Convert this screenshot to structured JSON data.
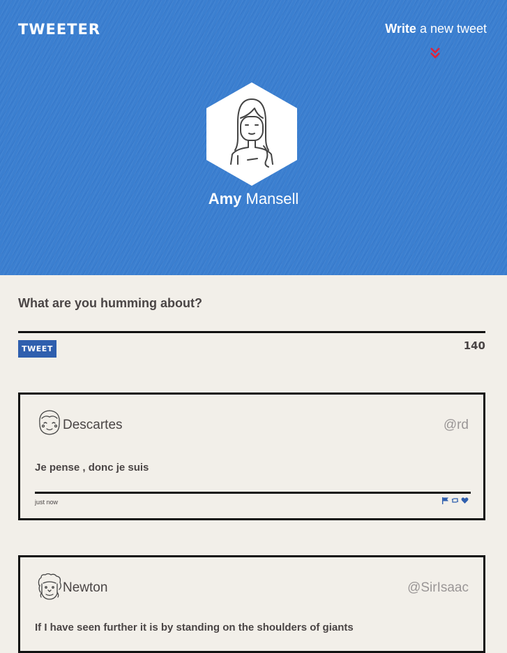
{
  "header": {
    "logo": "TWEETER",
    "write_bold": "Write",
    "write_rest": " a new tweet",
    "profile_first": "Amy",
    "profile_last": " Mansell"
  },
  "compose": {
    "prompt": "What are you humming about?",
    "button_label": "TWEET",
    "counter": "140"
  },
  "tweets": [
    {
      "author": "Descartes",
      "handle": "@rd",
      "text": "Je pense , donc je suis",
      "time": "just now"
    },
    {
      "author": "Newton",
      "handle": "@SirIsaac",
      "text": "If I have seen further it is by standing on the shoulders of giants"
    }
  ],
  "colors": {
    "header_blue": "#3b7fd0",
    "button_blue": "#2f5fae",
    "chevron_red": "#e0223a",
    "background": "#f2efe9"
  },
  "icons": {
    "chevron": "double-chevron-down-icon",
    "flag": "flag-icon",
    "retweet": "retweet-icon",
    "like": "heart-icon"
  }
}
